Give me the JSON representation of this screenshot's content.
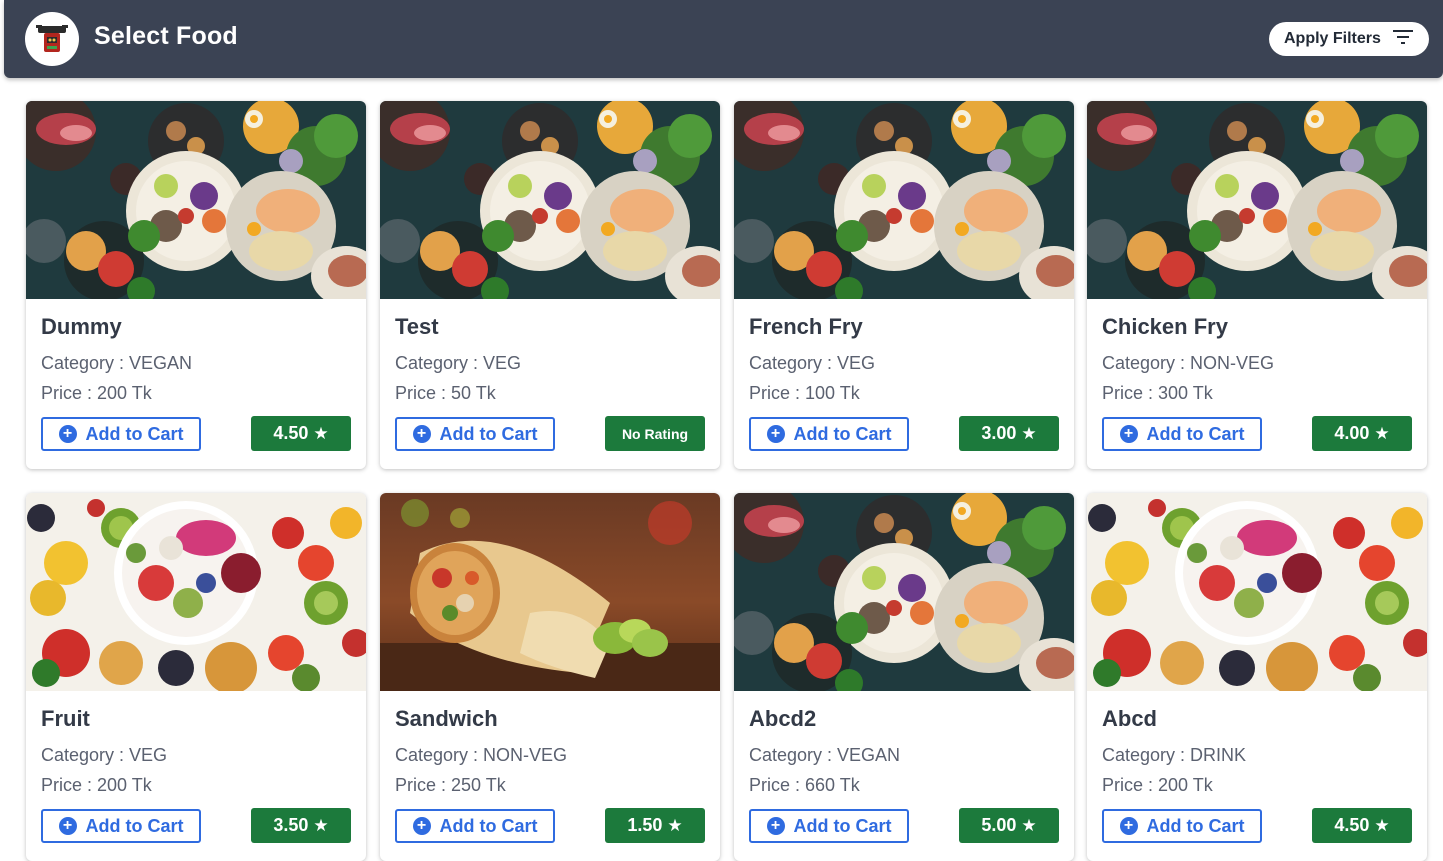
{
  "app": {
    "title": "Select Food",
    "filter_label": "Apply Filters"
  },
  "labels": {
    "category_prefix": "Category : ",
    "price_prefix": "Price : ",
    "price_suffix": " Tk",
    "add_to_cart": "Add to Cart"
  },
  "colors": {
    "appbar": "#3b4354",
    "accent": "#2f6be0",
    "rating_bg": "#1c7a3c"
  },
  "foods": [
    {
      "name": "Dummy",
      "category": "Category : VEGAN",
      "price": "Price : 200 Tk",
      "rating": "4.50",
      "image": "bowl-platter"
    },
    {
      "name": "Test",
      "category": "Category : VEG",
      "price": "Price : 50 Tk",
      "rating": "No Rating",
      "image": "bowl-platter"
    },
    {
      "name": "French Fry",
      "category": "Category : VEG",
      "price": "Price : 100 Tk",
      "rating": "3.00",
      "image": "bowl-platter"
    },
    {
      "name": "Chicken Fry",
      "category": "Category : NON-VEG",
      "price": "Price : 300 Tk",
      "rating": "4.00",
      "image": "bowl-platter"
    },
    {
      "name": "Fruit",
      "category": "Category : VEG",
      "price": "Price : 200 Tk",
      "rating": "3.50",
      "image": "fruit-bowl"
    },
    {
      "name": "Sandwich",
      "category": "Category : NON-VEG",
      "price": "Price : 250 Tk",
      "rating": "1.50",
      "image": "wrap"
    },
    {
      "name": "Abcd2",
      "category": "Category : VEGAN",
      "price": "Price : 660 Tk",
      "rating": "5.00",
      "image": "bowl-platter"
    },
    {
      "name": "Abcd",
      "category": "Category : DRINK",
      "price": "Price : 200 Tk",
      "rating": "4.50",
      "image": "fruit-bowl"
    }
  ]
}
